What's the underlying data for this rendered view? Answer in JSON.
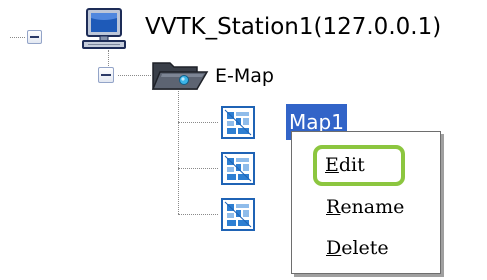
{
  "tree": {
    "station": {
      "label": "VVTK_Station1(127.0.0.1)",
      "icon": "computer-icon",
      "expanded": true
    },
    "emap": {
      "label": "E-Map",
      "icon": "open-folder-icon",
      "expanded": true
    },
    "maps": [
      {
        "label": "Map1",
        "icon": "map-icon",
        "selected": true
      },
      {
        "label": "",
        "icon": "map-icon",
        "selected": false
      },
      {
        "label": "",
        "icon": "map-icon",
        "selected": false
      }
    ]
  },
  "context_menu": {
    "items": [
      {
        "accel": "E",
        "rest": "dit",
        "highlighted": true
      },
      {
        "accel": "R",
        "rest": "ename",
        "highlighted": false
      },
      {
        "accel": "D",
        "rest": "elete",
        "highlighted": false
      }
    ]
  },
  "colors": {
    "selection": "#3264c8",
    "highlight_outline": "#8cc63f"
  }
}
